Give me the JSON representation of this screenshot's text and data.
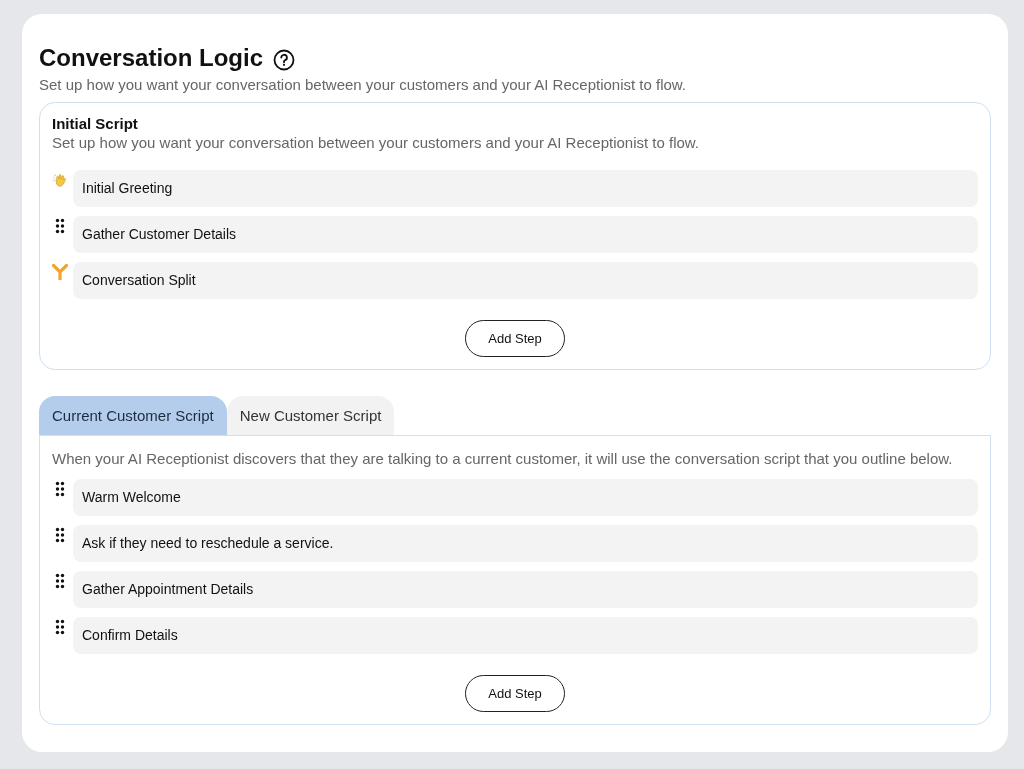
{
  "header": {
    "title": "Conversation Logic",
    "description": "Set up how you want your conversation between your customers and your AI Receptionist to flow."
  },
  "initial_script": {
    "title": "Initial Script",
    "description": "Set up how you want your conversation between your customers and your AI Receptionist to flow.",
    "steps": [
      {
        "kind": "wave",
        "label": "Initial Greeting"
      },
      {
        "kind": "drag",
        "label": "Gather Customer Details"
      },
      {
        "kind": "split",
        "label": "Conversation Split"
      }
    ],
    "add_button": "Add Step"
  },
  "tabs": [
    {
      "label": "Current Customer Script",
      "selected": true
    },
    {
      "label": "New Customer Script",
      "selected": false
    }
  ],
  "tab_panel": {
    "description": "When your AI Receptionist discovers that they are talking to a current customer, it will use the conversation script that you outline below.",
    "steps": [
      {
        "kind": "drag",
        "label": "Warm Welcome"
      },
      {
        "kind": "drag",
        "label": "Ask if they need to reschedule a service."
      },
      {
        "kind": "drag",
        "label": "Gather Appointment Details"
      },
      {
        "kind": "drag",
        "label": "Confirm Details"
      }
    ],
    "add_button": "Add Step"
  }
}
